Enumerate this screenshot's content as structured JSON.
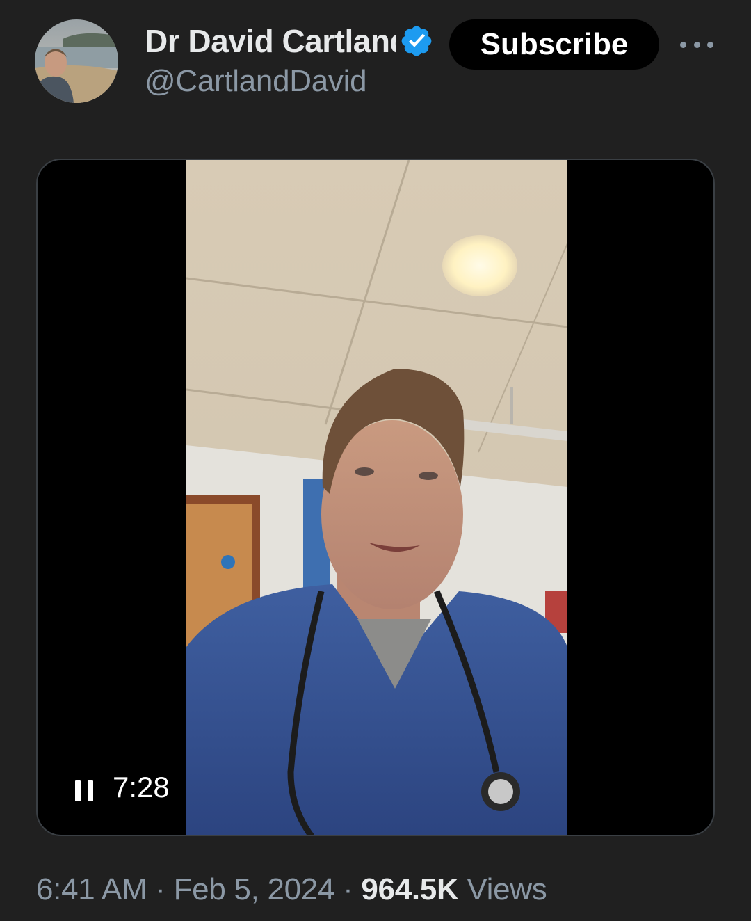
{
  "author": {
    "display_name": "Dr David Cartland",
    "handle": "@CartlandDavid",
    "verified_icon": "verified-badge-icon",
    "avatar_icon": "avatar"
  },
  "actions": {
    "subscribe_label": "Subscribe",
    "more_icon": "more-horizontal-icon"
  },
  "video": {
    "state_icon": "pause-icon",
    "duration": "7:28"
  },
  "meta": {
    "time": "6:41 AM",
    "separator": "·",
    "date": "Feb 5, 2024",
    "views_count": "964.5K",
    "views_label": "Views"
  },
  "colors": {
    "background": "#202020",
    "verified": "#1d9bf0",
    "secondary_text": "#8b98a5",
    "primary_text": "#e7e9ea"
  }
}
